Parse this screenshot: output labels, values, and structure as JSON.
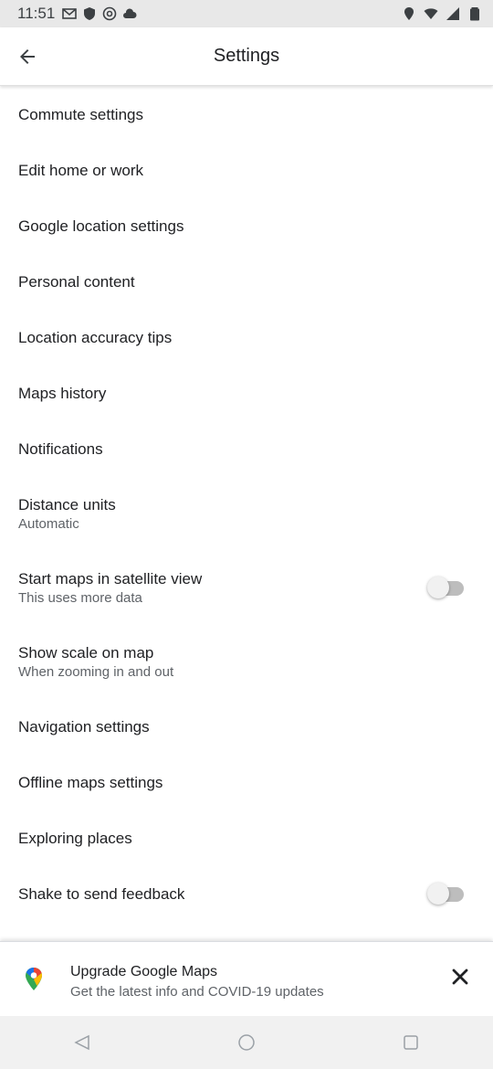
{
  "status_bar": {
    "time": "11:51",
    "icons_left": [
      "gmail-icon",
      "shield-icon",
      "at-sign-icon",
      "cloud-icon"
    ],
    "icons_right": [
      "location-icon",
      "wifi-icon",
      "signal-icon",
      "battery-icon"
    ]
  },
  "app_bar": {
    "title": "Settings"
  },
  "settings": {
    "items": [
      {
        "label": "Commute settings"
      },
      {
        "label": "Edit home or work"
      },
      {
        "label": "Google location settings"
      },
      {
        "label": "Personal content"
      },
      {
        "label": "Location accuracy tips"
      },
      {
        "label": "Maps history"
      },
      {
        "label": "Notifications"
      },
      {
        "label": "Distance units",
        "sub": "Automatic"
      },
      {
        "label": "Start maps in satellite view",
        "sub": "This uses more data",
        "toggle": "off"
      },
      {
        "label": "Show scale on map",
        "sub": "When zooming in and out"
      },
      {
        "label": "Navigation settings"
      },
      {
        "label": "Offline maps settings"
      },
      {
        "label": "Exploring places"
      },
      {
        "label": "Shake to send feedback",
        "toggle": "off"
      }
    ]
  },
  "banner": {
    "title": "Upgrade Google Maps",
    "subtitle": "Get the latest info and COVID-19 updates",
    "icon": "google-maps-pin-icon"
  },
  "colors": {
    "text_primary": "#202124",
    "text_secondary": "#5f6368",
    "toggle_off_track": "#bdbdbd"
  }
}
